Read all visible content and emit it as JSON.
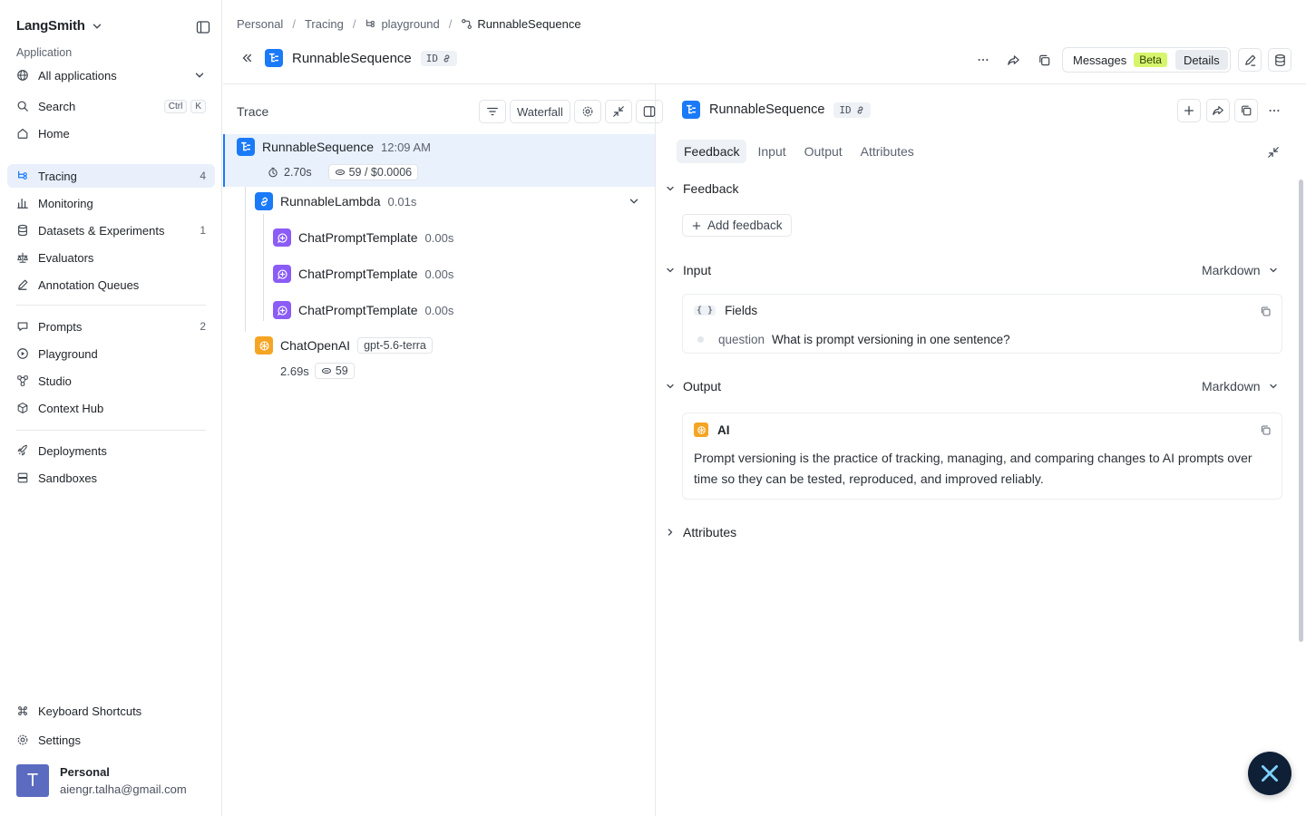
{
  "sidebar": {
    "brand": "LangSmith",
    "section_label": "Application",
    "app_selector": "All applications",
    "search": {
      "label": "Search",
      "keys": [
        "Ctrl",
        "K"
      ]
    },
    "home": "Home",
    "items": [
      {
        "label": "Tracing",
        "count": "4"
      },
      {
        "label": "Monitoring",
        "count": ""
      },
      {
        "label": "Datasets & Experiments",
        "count": "1"
      },
      {
        "label": "Evaluators",
        "count": ""
      },
      {
        "label": "Annotation Queues",
        "count": ""
      },
      {
        "label": "Prompts",
        "count": "2"
      },
      {
        "label": "Playground",
        "count": ""
      },
      {
        "label": "Studio",
        "count": ""
      },
      {
        "label": "Context Hub",
        "count": ""
      },
      {
        "label": "Deployments",
        "count": ""
      },
      {
        "label": "Sandboxes",
        "count": ""
      }
    ],
    "keyboard_shortcuts": "Keyboard Shortcuts",
    "settings": "Settings",
    "user": {
      "initial": "T",
      "name": "Personal",
      "email": "aiengr.talha@gmail.com"
    }
  },
  "breadcrumb": [
    "Personal",
    "Tracing",
    "playground",
    "RunnableSequence"
  ],
  "header": {
    "title": "RunnableSequence",
    "id_label": "ID",
    "messages_label": "Messages",
    "beta_label": "Beta",
    "details_label": "Details"
  },
  "trace": {
    "title": "Trace",
    "waterfall_label": "Waterfall",
    "root": {
      "name": "RunnableSequence",
      "time": "12:09 AM",
      "duration": "2.70s",
      "tokens_cost": "59 / $0.0006"
    },
    "lambda": {
      "name": "RunnableLambda",
      "duration": "0.01s"
    },
    "prompts": [
      {
        "name": "ChatPromptTemplate",
        "duration": "0.00s"
      },
      {
        "name": "ChatPromptTemplate",
        "duration": "0.00s"
      },
      {
        "name": "ChatPromptTemplate",
        "duration": "0.00s"
      }
    ],
    "llm": {
      "name": "ChatOpenAI",
      "model": "gpt-5.6-terra",
      "duration": "2.69s",
      "tokens": "59"
    }
  },
  "details": {
    "title": "RunnableSequence",
    "id_label": "ID",
    "tabs": [
      "Feedback",
      "Input",
      "Output",
      "Attributes"
    ],
    "feedback": {
      "title": "Feedback",
      "add_label": "Add feedback"
    },
    "input": {
      "title": "Input",
      "format": "Markdown",
      "card_title": "Fields",
      "field_key": "question",
      "field_value": "What is prompt versioning in one sentence?"
    },
    "output": {
      "title": "Output",
      "format": "Markdown",
      "card_title": "AI",
      "text": "Prompt versioning is the practice of tracking, managing, and comparing changes to AI prompts over time so they can be tested, reproduced, and improved reliably."
    },
    "attributes_title": "Attributes"
  },
  "colors": {
    "accent_blue": "#1a7af8",
    "prompt_purple": "#8b5cf6",
    "llm_orange": "#f5a524",
    "beta_green": "#d7f56c"
  }
}
